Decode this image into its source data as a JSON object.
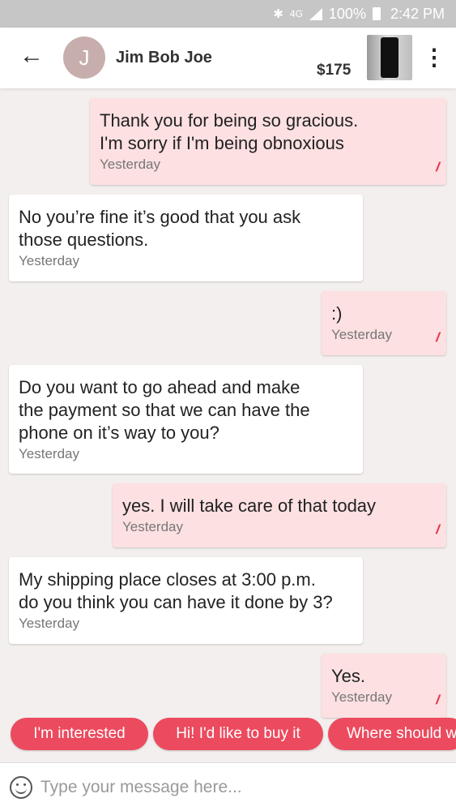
{
  "status_bar": {
    "bluetooth": "bluetooth-icon",
    "network": "4G",
    "battery_percent": "100%",
    "time": "2:42 PM"
  },
  "header": {
    "avatar_initial": "J",
    "contact_name": "Jim Bob Joe",
    "price": "$175"
  },
  "messages": [
    {
      "direction": "out",
      "text": "Thank you for being so gracious.\nI'm sorry if I'm being obnoxious",
      "time": "Yesterday",
      "read": true
    },
    {
      "direction": "in",
      "text": "No you’re fine it’s good that you ask\nthose questions.",
      "time": "Yesterday"
    },
    {
      "direction": "out",
      "text": ":)",
      "time": "Yesterday",
      "read": true
    },
    {
      "direction": "in",
      "text": "Do you want to go ahead and make\nthe payment so that we can have the\nphone on it’s way to you?",
      "time": "Yesterday"
    },
    {
      "direction": "out",
      "text": "yes. I will take care of that today",
      "time": "Yesterday",
      "read": true
    },
    {
      "direction": "in",
      "text": "My shipping place closes at 3:00 p.m.\ndo you think you can have it done by 3?",
      "time": "Yesterday"
    },
    {
      "direction": "out",
      "text": "Yes.",
      "time": "Yesterday",
      "read": true
    }
  ],
  "quick_replies": [
    "I'm interested",
    "Hi! I'd like to buy it",
    "Where should we meet?"
  ],
  "composer": {
    "placeholder": "Type your message here..."
  },
  "colors": {
    "accent": "#ec4a5e",
    "outgoing_bubble": "#fde0e2",
    "incoming_bubble": "#ffffff",
    "read_ticks": "#e03f52"
  }
}
